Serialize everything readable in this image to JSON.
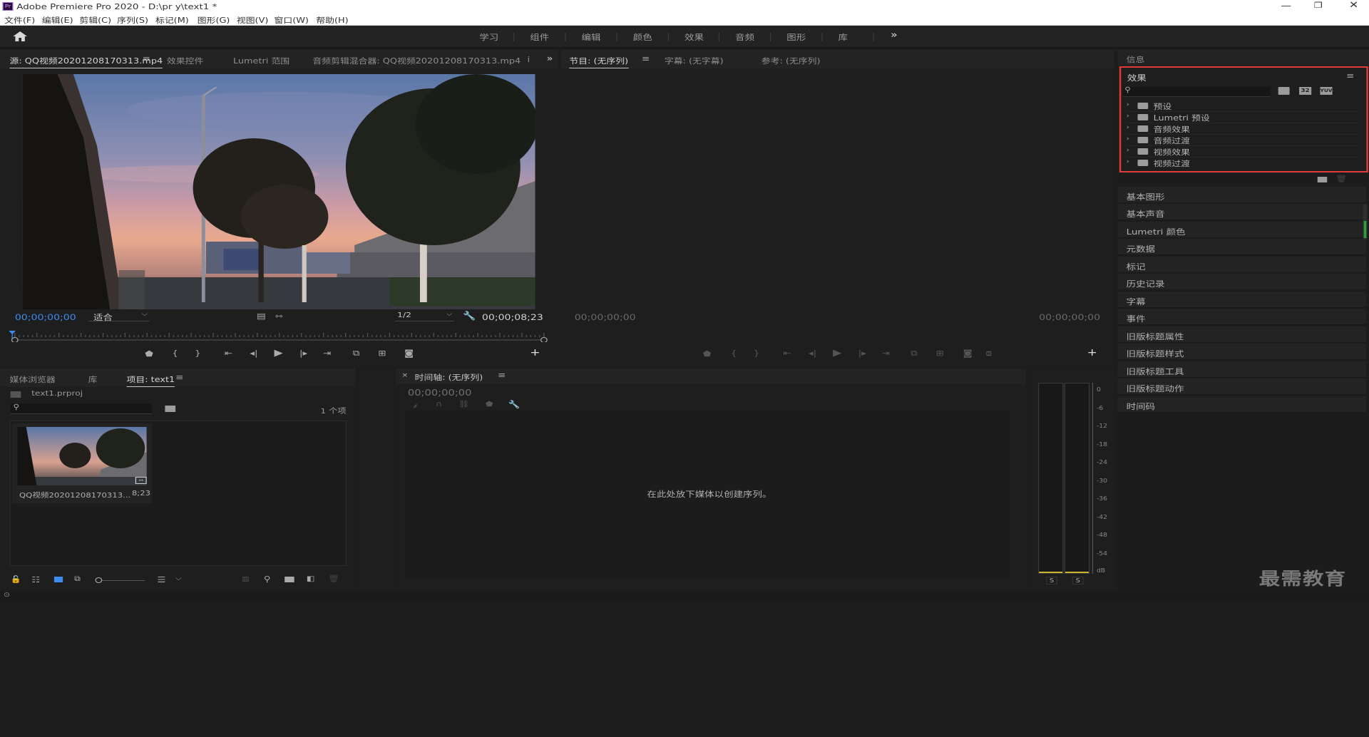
{
  "window": {
    "title": "Adobe Premiere Pro 2020 - D:\\pr y\\text1 *",
    "app_icon": "Pr"
  },
  "menu": [
    "文件(F)",
    "编辑(E)",
    "剪辑(C)",
    "序列(S)",
    "标记(M)",
    "图形(G)",
    "视图(V)",
    "窗口(W)",
    "帮助(H)"
  ],
  "workspaces": [
    "学习",
    "组件",
    "编辑",
    "颜色",
    "效果",
    "音频",
    "图形",
    "库"
  ],
  "source": {
    "tabs": [
      "源: QQ视频20201208170313.mp4",
      "效果控件",
      "Lumetri 范围",
      "音频剪辑混合器: QQ视频20201208170313.mp4",
      "i"
    ],
    "timecode_current": "00;00;00;00",
    "zoom": "适合",
    "resolution": "1/2",
    "timecode_duration": "00;00;08;23"
  },
  "program": {
    "tabs": [
      "节目: (无序列)",
      "字幕: (无字幕)",
      "参考: (无序列)"
    ],
    "timecode_current": "00;00;00;00",
    "timecode_duration": "00;00;00;00"
  },
  "effects": {
    "info_tab": "信息",
    "title": "效果",
    "search_placeholder": "",
    "badges": [
      "32",
      "YUV"
    ],
    "items": [
      "预设",
      "Lumetri 预设",
      "音频效果",
      "音频过渡",
      "视频效果",
      "视频过渡"
    ],
    "highlight_color": "#e03c3c"
  },
  "side_panels": [
    "基本图形",
    "基本声音",
    "Lumetri 颜色",
    "元数据",
    "标记",
    "历史记录",
    "字幕",
    "事件",
    "旧版标题属性",
    "旧版标题样式",
    "旧版标题工具",
    "旧版标题动作",
    "时间码"
  ],
  "project": {
    "tabs": [
      "媒体浏览器",
      "库",
      "项目: text1"
    ],
    "file": "text1.prproj",
    "count": "1 个项",
    "clip_name": "QQ视频20201208170313...",
    "clip_duration": "8;23"
  },
  "timeline": {
    "tab": "时间轴: (无序列)",
    "timecode": "00;00;00;00",
    "empty_message": "在此处放下媒体以创建序列。"
  },
  "audio_meter": {
    "scale": [
      "0",
      "-6",
      "-12",
      "-18",
      "-24",
      "-30",
      "-36",
      "-42",
      "-48",
      "-54",
      "dB"
    ],
    "solo_labels": [
      "S",
      "S"
    ]
  },
  "watermark": "最需教育",
  "colors": {
    "accent": "#3d8cf0",
    "highlight": "#e03c3c"
  }
}
